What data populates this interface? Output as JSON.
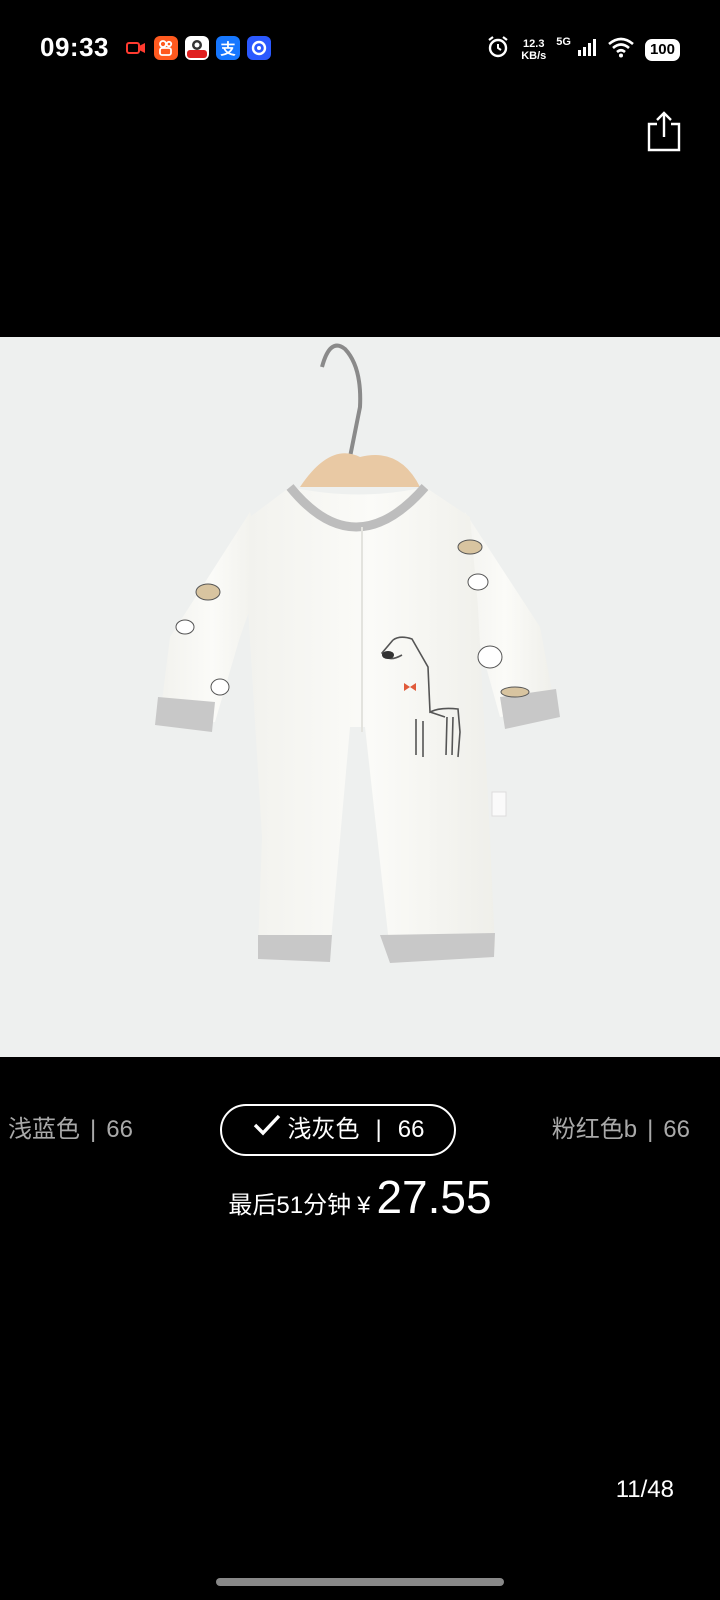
{
  "status_bar": {
    "time": "09:33",
    "network_speed_value": "12.3",
    "network_speed_unit": "KB/s",
    "network_type": "5G",
    "battery": "100",
    "icons": [
      "screen-record-icon",
      "kuaishou-app-icon",
      "app-notification-icon",
      "alipay-icon",
      "baidu-netdisk-icon",
      "alarm-icon",
      "signal-icon",
      "wifi-icon",
      "battery-icon"
    ]
  },
  "toolbar": {
    "share_icon": "share-icon"
  },
  "product": {
    "image_name": "baby-romper-light-gray"
  },
  "variants": [
    {
      "color": "浅蓝色",
      "separator": "|",
      "size": "66",
      "selected": false
    },
    {
      "color": "浅灰色",
      "separator": "|",
      "size": "66",
      "selected": true
    },
    {
      "color": "粉红色b",
      "separator": "|",
      "size": "66",
      "selected": false
    }
  ],
  "price_info": {
    "label": "最后51分钟",
    "currency": "¥",
    "price": "27.55"
  },
  "pager": {
    "indicator": "11/48"
  },
  "colors": {
    "background": "#000000",
    "image_background": "#eef0ef",
    "variant_inactive": "#a9a9a9",
    "text": "#ffffff"
  }
}
